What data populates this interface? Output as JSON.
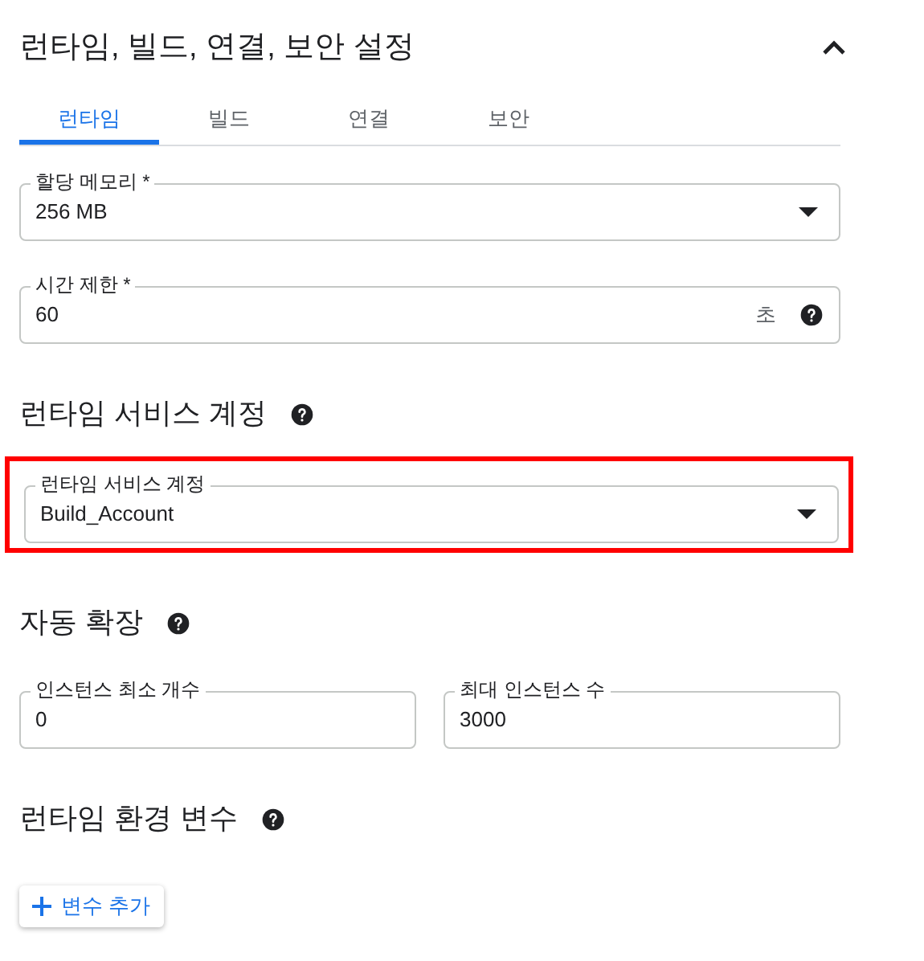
{
  "header": {
    "title": "런타임, 빌드, 연결, 보안 설정",
    "expanded": true
  },
  "tabs": [
    {
      "label": "런타임",
      "selected": true
    },
    {
      "label": "빌드",
      "selected": false
    },
    {
      "label": "연결",
      "selected": false
    },
    {
      "label": "보안",
      "selected": false
    }
  ],
  "fields": [
    {
      "kind": "select",
      "label": "할당 메모리 *",
      "value": "256 MB"
    },
    {
      "kind": "text",
      "label": "시간 제한 *",
      "value": "60",
      "unit": "초",
      "help": true
    }
  ],
  "service_account": {
    "title": "런타임 서비스 계정",
    "highlighted": true,
    "field": {
      "kind": "select",
      "label": "런타임 서비스 계정",
      "value": "Build_Account"
    }
  },
  "autoscaling": {
    "title": "자동 확장",
    "fields": [
      {
        "label": "인스턴스 최소 개수",
        "value": "0"
      },
      {
        "label": "최대 인스턴스 수",
        "value": "3000"
      }
    ]
  },
  "env": {
    "title": "런타임 환경 변수",
    "button": "변수 추가"
  }
}
